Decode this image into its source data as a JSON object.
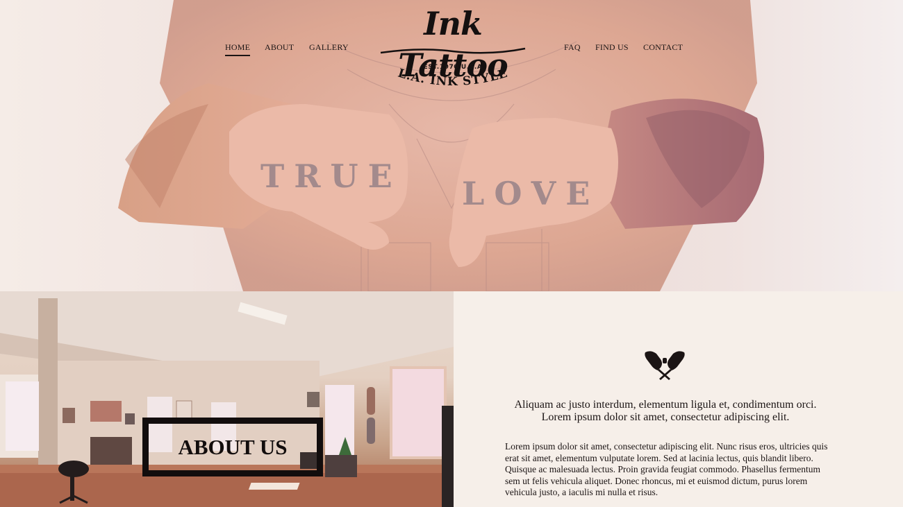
{
  "nav": {
    "left": [
      {
        "label": "HOME",
        "active": true
      },
      {
        "label": "ABOUT",
        "active": false
      },
      {
        "label": "GALLERY",
        "active": false
      }
    ],
    "right": [
      {
        "label": "FAQ",
        "active": false
      },
      {
        "label": "FIND US",
        "active": false
      },
      {
        "label": "CONTACT",
        "active": false
      }
    ]
  },
  "logo": {
    "script": "Ink Tattoo",
    "established": "EST.1970 U.S.A",
    "style": "L.A. INK STYLE"
  },
  "hero": {
    "knuckles_left": "TRUE",
    "knuckles_right": "LOVE"
  },
  "about": {
    "button_label": "ABOUT US"
  },
  "content": {
    "tagline_line1": "Aliquam ac justo interdum, elementum ligula et, condimentum orci.",
    "tagline_line2": "Lorem ipsum dolor sit amet, consectetur adipiscing elit.",
    "paragraph1": "Lorem ipsum dolor sit amet, consectetur adipiscing elit. Nunc risus eros, ultricies quis erat sit amet, elementum vulputate lorem. Sed at lacinia lectus, quis blandit libero.",
    "paragraph2": "Quisque ac malesuada lectus. Proin gravida feugiat commodo. Phasellus fermentum sem ut felis vehicula aliquet. Donec rhoncus, mi et euismod dictum, purus lorem vehicula justo, a iaculis mi nulla et risus."
  },
  "colors": {
    "ink": "#1b1414",
    "page_background": "#f6efe9",
    "skin": "#d79f8f"
  },
  "icons": {
    "machines": "crossed-tattoo-machines-icon"
  }
}
